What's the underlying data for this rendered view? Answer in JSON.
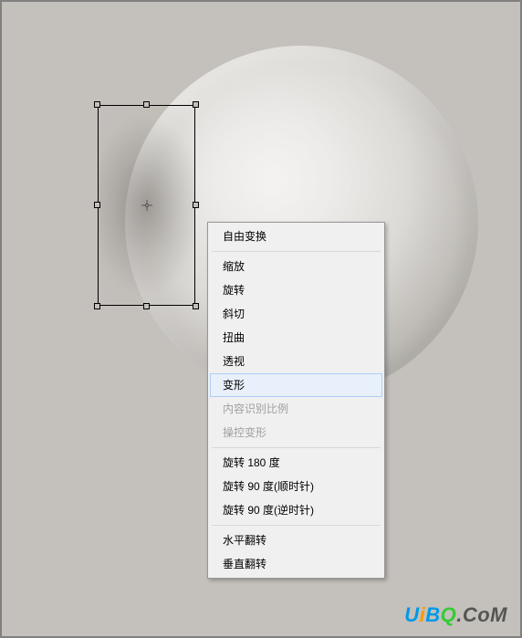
{
  "menu": {
    "group1": [
      {
        "label": "自由变换",
        "disabled": false,
        "highlighted": false
      }
    ],
    "group2": [
      {
        "label": "缩放",
        "disabled": false,
        "highlighted": false
      },
      {
        "label": "旋转",
        "disabled": false,
        "highlighted": false
      },
      {
        "label": "斜切",
        "disabled": false,
        "highlighted": false
      },
      {
        "label": "扭曲",
        "disabled": false,
        "highlighted": false
      },
      {
        "label": "透视",
        "disabled": false,
        "highlighted": false
      },
      {
        "label": "变形",
        "disabled": false,
        "highlighted": true
      },
      {
        "label": "内容识别比例",
        "disabled": true,
        "highlighted": false
      },
      {
        "label": "操控变形",
        "disabled": true,
        "highlighted": false
      }
    ],
    "group3": [
      {
        "label": "旋转 180 度",
        "disabled": false,
        "highlighted": false
      },
      {
        "label": "旋转 90 度(顺时针)",
        "disabled": false,
        "highlighted": false
      },
      {
        "label": "旋转 90 度(逆时针)",
        "disabled": false,
        "highlighted": false
      }
    ],
    "group4": [
      {
        "label": "水平翻转",
        "disabled": false,
        "highlighted": false
      },
      {
        "label": "垂直翻转",
        "disabled": false,
        "highlighted": false
      }
    ]
  },
  "watermark": {
    "a": "U",
    "b": "i",
    "c": "B",
    "d": "Q",
    "e": ".CoM"
  }
}
